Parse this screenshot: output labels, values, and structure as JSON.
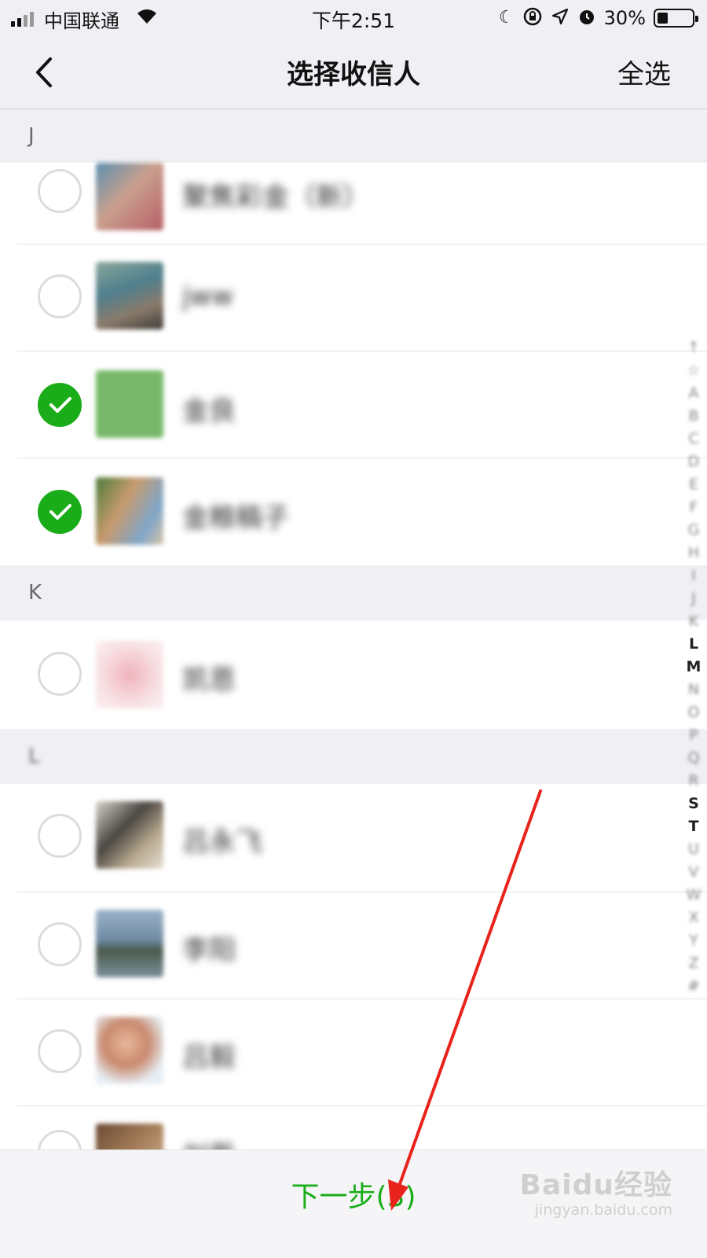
{
  "status_bar": {
    "carrier": "中国联通",
    "time": "下午2:51",
    "battery": "30%",
    "battery_level": 0.3,
    "icons": [
      "signal-icon",
      "wifi-icon",
      "moon-icon",
      "rotation-lock-icon",
      "location-icon",
      "alarm-icon",
      "battery-icon"
    ]
  },
  "nav": {
    "back_icon": "chevron-left-icon",
    "title": "选择收信人",
    "select_all": "全选"
  },
  "sections": [
    {
      "letter": "J",
      "contacts": [
        {
          "name": "聚焦彩金（新）",
          "checked": false
        },
        {
          "name": "jww",
          "checked": false
        },
        {
          "name": "金良",
          "checked": true
        },
        {
          "name": "金粮稿子",
          "checked": true
        }
      ]
    },
    {
      "letter": "K",
      "contacts": [
        {
          "name": "凯恩",
          "checked": false
        }
      ]
    },
    {
      "letter": "L",
      "contacts": [
        {
          "name": "吕永飞",
          "checked": false
        },
        {
          "name": "李阳",
          "checked": false
        },
        {
          "name": "吕毅",
          "checked": false
        },
        {
          "name": "刘磊",
          "checked": false
        }
      ]
    }
  ],
  "index_bar": [
    "↑",
    "☆",
    "A",
    "B",
    "C",
    "D",
    "E",
    "F",
    "G",
    "H",
    "I",
    "J",
    "K",
    "L",
    "M",
    "N",
    "O",
    "P",
    "Q",
    "R",
    "S",
    "T",
    "U",
    "V",
    "W",
    "X",
    "Y",
    "Z",
    "#"
  ],
  "bottom": {
    "next_label": "下一步(3)"
  },
  "watermark": {
    "main": "Baidu经验",
    "sub": "jingyan.baidu.com"
  },
  "colors": {
    "accent_green": "#1aad19",
    "nav_bg": "#efeff4",
    "annotation_red": "#e8231c"
  }
}
